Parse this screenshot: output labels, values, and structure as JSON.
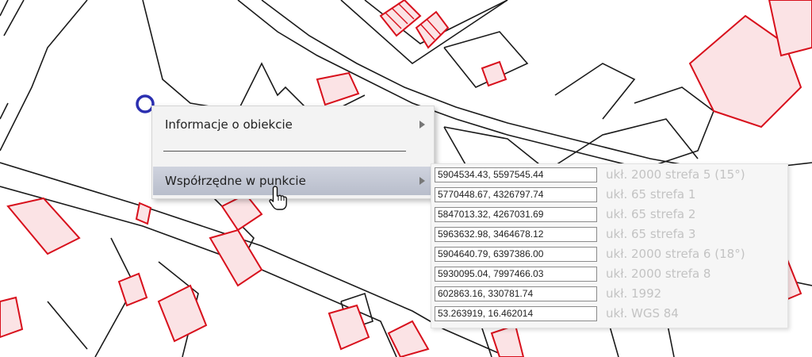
{
  "context_menu": {
    "items": [
      {
        "label": "Informacje o obiekcie",
        "has_submenu": true
      },
      {
        "label": "Współrzędne w punkcie",
        "has_submenu": true,
        "highlighted": true
      }
    ]
  },
  "coordinates": [
    {
      "value": "5904534.43, 5597545.44",
      "system": "ukł. 2000 strefa 5 (15°)"
    },
    {
      "value": "5770448.67, 4326797.74",
      "system": "ukł. 65 strefa 1"
    },
    {
      "value": "5847013.32, 4267031.69",
      "system": "ukł. 65 strefa 2"
    },
    {
      "value": "5963632.98, 3464678.12",
      "system": "ukł. 65 strefa 3"
    },
    {
      "value": "5904640.79, 6397386.00",
      "system": "ukł. 2000 strefa 6 (18°)"
    },
    {
      "value": "5930095.04, 7997466.03",
      "system": "ukł. 2000 strefa 8"
    },
    {
      "value": "602863.16, 330781.74",
      "system": "ukł. 1992"
    },
    {
      "value": "53.263919, 16.462014",
      "system": "ukł. WGS 84"
    }
  ],
  "map": {
    "parcel_line_color": "#1a1a1a",
    "building_outline_color": "#d8101c",
    "building_fill_color": "#fbe3e5",
    "marker_color": "#2b2fb0",
    "marker_icon": "circle-marker-icon"
  },
  "cursor_icon": "hand-pointer-icon"
}
